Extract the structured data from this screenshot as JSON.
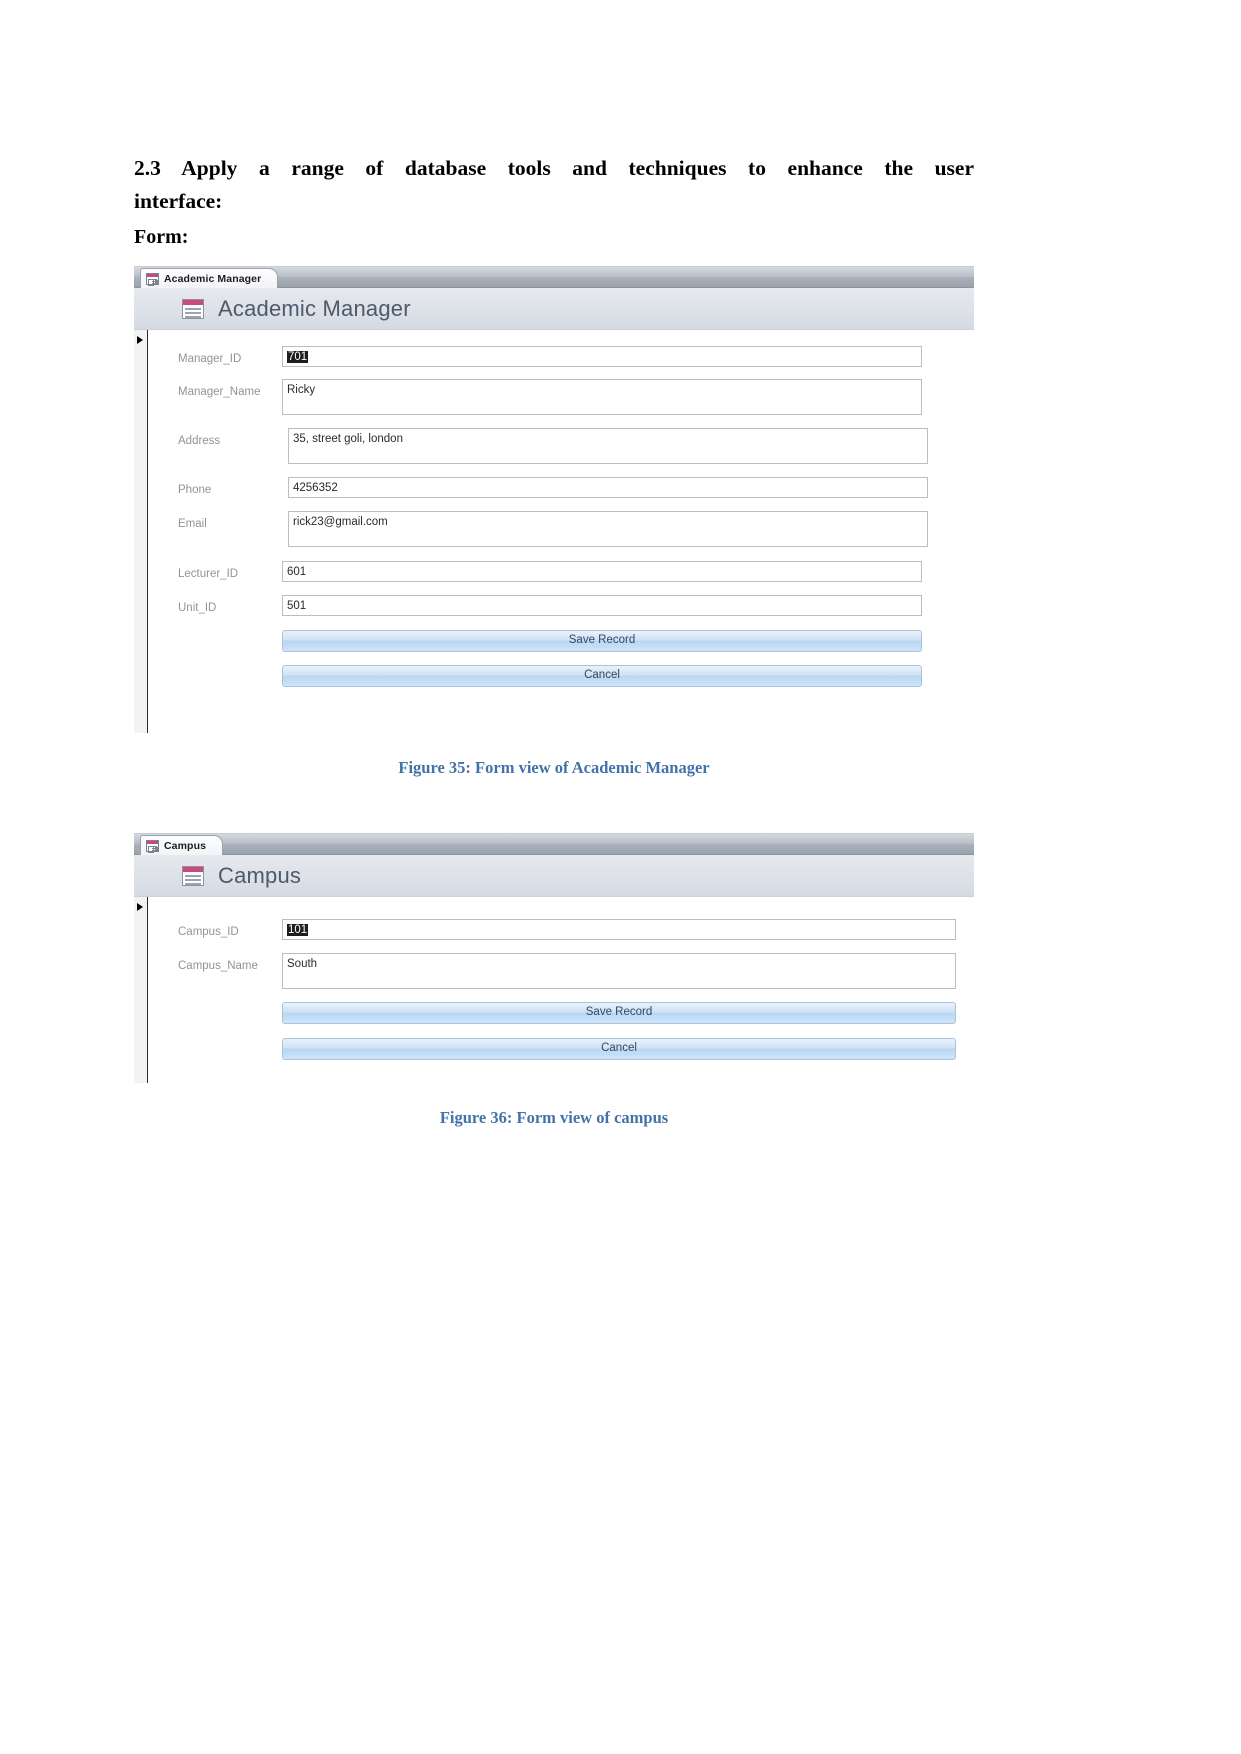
{
  "document": {
    "heading_number": "2.3",
    "heading_text": "Apply a range of database tools and techniques to enhance the user interface:",
    "heading_line1": "2.3  Apply  a  range  of  database  tools  and  techniques  to  enhance  the  user",
    "heading_line2": "interface:",
    "subheading": "Form",
    "subheading_colon": ":"
  },
  "figure1": {
    "tab_label": "Academic Manager",
    "form_title": "Academic Manager",
    "fields": [
      {
        "label": "Manager_ID",
        "value": "701",
        "selected": true,
        "tall": false
      },
      {
        "label": "Manager_Name",
        "value": "Ricky",
        "selected": false,
        "tall": true
      },
      {
        "label": "Address",
        "value": "35, street goli, london",
        "selected": false,
        "tall": true
      },
      {
        "label": "Phone",
        "value": "4256352",
        "selected": false,
        "tall": false
      },
      {
        "label": "Email",
        "value": "rick23@gmail.com",
        "selected": false,
        "tall": true
      },
      {
        "label": "Lecturer_ID",
        "value": "601",
        "selected": false,
        "tall": false
      },
      {
        "label": "Unit_ID",
        "value": "501",
        "selected": false,
        "tall": false
      }
    ],
    "buttons": [
      {
        "label": "Save Record"
      },
      {
        "label": "Cancel"
      }
    ],
    "caption": "Figure 35: Form view of Academic Manager"
  },
  "figure2": {
    "tab_label": "Campus",
    "form_title": "Campus",
    "fields": [
      {
        "label": "Campus_ID",
        "value": "101",
        "selected": true,
        "tall": false
      },
      {
        "label": "Campus_Name",
        "value": "South",
        "selected": false,
        "tall": true
      }
    ],
    "buttons": [
      {
        "label": "Save Record"
      },
      {
        "label": "Cancel"
      }
    ],
    "caption": "Figure 36: Form view of campus"
  },
  "icons": {
    "tab_icon": "access-form-icon",
    "header_icon": "access-form-icon-large",
    "record_selector": "record-selector-arrow"
  },
  "colors": {
    "caption_blue": "#4472a8",
    "icon_pink": "#c94b7c",
    "title_gray": "#4c5a6b",
    "label_gray": "#8f949b",
    "button_blue": "#b9d6f2"
  }
}
